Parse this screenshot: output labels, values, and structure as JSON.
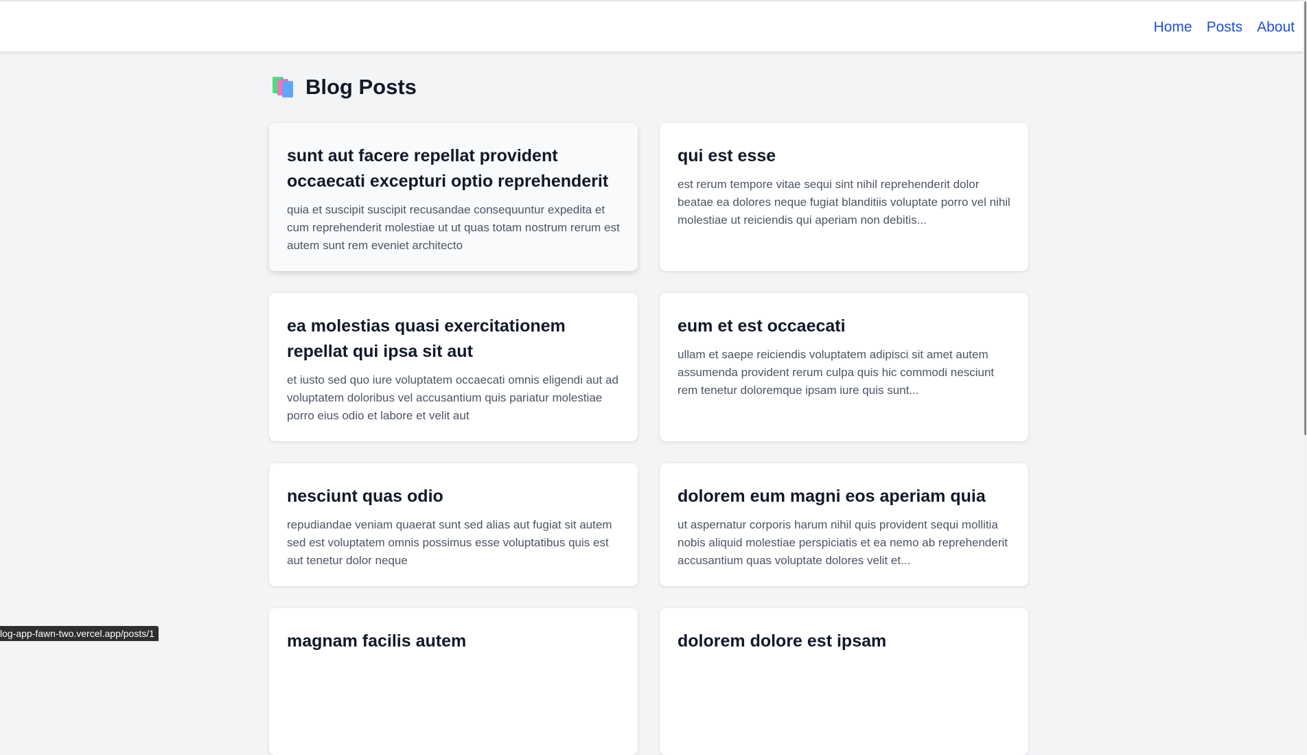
{
  "nav": {
    "links": [
      "Home",
      "Posts",
      "About"
    ]
  },
  "page": {
    "title": "Blog Posts",
    "icon": "books-icon"
  },
  "posts": [
    {
      "title": "sunt aut facere repellat provident occaecati excepturi optio reprehenderit",
      "body": "quia et suscipit suscipit recusandae consequuntur expedita et cum reprehenderit molestiae ut ut quas totam nostrum rerum est autem sunt rem eveniet architecto"
    },
    {
      "title": "qui est esse",
      "body": "est rerum tempore vitae sequi sint nihil reprehenderit dolor beatae ea dolores neque fugiat blanditiis voluptate porro vel nihil molestiae ut reiciendis qui aperiam non debitis..."
    },
    {
      "title": "ea molestias quasi exercitationem repellat qui ipsa sit aut",
      "body": "et iusto sed quo iure voluptatem occaecati omnis eligendi aut ad voluptatem doloribus vel accusantium quis pariatur molestiae porro eius odio et labore et velit aut"
    },
    {
      "title": "eum et est occaecati",
      "body": "ullam et saepe reiciendis voluptatem adipisci sit amet autem assumenda provident rerum culpa quis hic commodi nesciunt rem tenetur doloremque ipsam iure quis sunt..."
    },
    {
      "title": "nesciunt quas odio",
      "body": "repudiandae veniam quaerat sunt sed alias aut fugiat sit autem sed est voluptatem omnis possimus esse voluptatibus quis est aut tenetur dolor neque"
    },
    {
      "title": "dolorem eum magni eos aperiam quia",
      "body": "ut aspernatur corporis harum nihil quis provident sequi mollitia nobis aliquid molestiae perspiciatis et ea nemo ab reprehenderit accusantium quas voluptate dolores velit et..."
    },
    {
      "title": "magnam facilis autem",
      "body": ""
    },
    {
      "title": "dolorem dolore est ipsam",
      "body": ""
    }
  ],
  "status_bar": {
    "url": "log-app-fawn-two.vercel.app/posts/1"
  }
}
